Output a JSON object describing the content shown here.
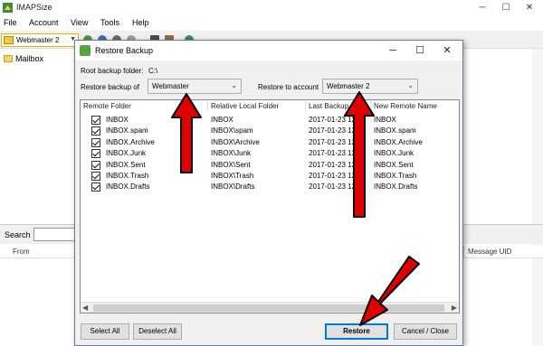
{
  "main_window": {
    "title": "IMAPSize",
    "menu": [
      "File",
      "Account",
      "View",
      "Tools",
      "Help"
    ],
    "account_select": "Webmaster 2",
    "tree_item": "Mailbox",
    "search_label": "Search",
    "columns": {
      "from": "From",
      "uid": "Message UID"
    },
    "window_controls": {
      "minimize": "─",
      "maximize": "☐",
      "close": "✕"
    }
  },
  "dialog": {
    "title": "Restore Backup",
    "window_controls": {
      "minimize": "─",
      "maximize": "☐",
      "close": "✕"
    },
    "root_label": "Root backup folder:",
    "root_value": "C:\\",
    "restore_of_label": "Restore backup of",
    "restore_of_value": "Webmaster",
    "restore_to_label": "Restore to account",
    "restore_to_value": "Webmaster 2",
    "columns": [
      "Remote Folder",
      "Relative Local Folder",
      "Last Backup",
      "New Remote Name"
    ],
    "rows": [
      {
        "checked": true,
        "remote": "INBOX",
        "local": "INBOX",
        "last": "2017-01-23 12:50",
        "new_name": "INBOX"
      },
      {
        "checked": true,
        "remote": "INBOX.spam",
        "local": "INBOX\\spam",
        "last": "2017-01-23 12:50",
        "new_name": "INBOX.spam"
      },
      {
        "checked": true,
        "remote": "INBOX.Archive",
        "local": "INBOX\\Archive",
        "last": "2017-01-23 12:50",
        "new_name": "INBOX.Archive"
      },
      {
        "checked": true,
        "remote": "INBOX.Junk",
        "local": "INBOX\\Junk",
        "last": "2017-01-23 12:50",
        "new_name": "INBOX.Junk"
      },
      {
        "checked": true,
        "remote": "INBOX.Sent",
        "local": "INBOX\\Sent",
        "last": "2017-01-23 12:50",
        "new_name": "INBOX.Sent"
      },
      {
        "checked": true,
        "remote": "INBOX.Trash",
        "local": "INBOX\\Trash",
        "last": "2017-01-23 12:50",
        "new_name": "INBOX.Trash"
      },
      {
        "checked": true,
        "remote": "INBOX.Drafts",
        "local": "INBOX\\Drafts",
        "last": "2017-01-23 12:50",
        "new_name": "INBOX.Drafts"
      }
    ],
    "buttons": {
      "select_all": "Select All",
      "deselect_all": "Deselect All",
      "restore": "Restore",
      "cancel": "Cancel / Close"
    }
  },
  "colors": {
    "annotation_arrow": "#e00000",
    "accent": "#0078d7"
  },
  "icons": [
    "app-icon",
    "folder-icon",
    "restore-backup-icon",
    "checkbox-checked-icon",
    "dropdown-arrow-icon"
  ]
}
